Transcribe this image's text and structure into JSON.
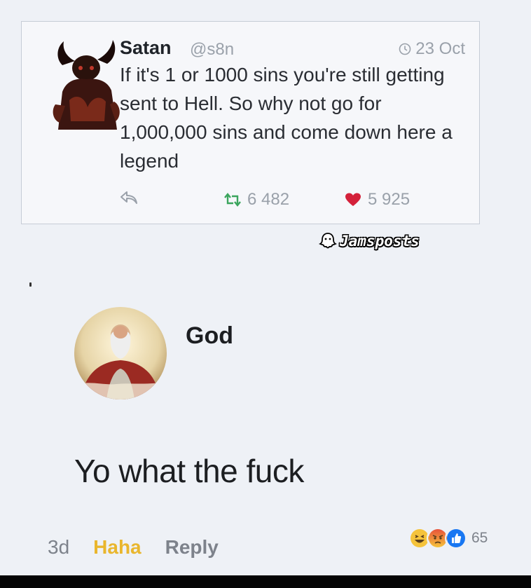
{
  "tweet": {
    "name": "Satan",
    "handle": "@s8n",
    "date": "23 Oct",
    "text": "If it's 1 or 1000 sins you're still getting sent to Hell. So why not go for 1,000,000 sins and come down here a legend",
    "retweets": "6 482",
    "likes": "5 925",
    "colors": {
      "retweet": "#3ba55d",
      "like": "#d4213a"
    }
  },
  "watermark": {
    "text": "Jamsposts",
    "icon": "ghost-icon"
  },
  "comment": {
    "name": "God",
    "text": "Yo what the fuck",
    "time": "3d",
    "haha_label": "Haha",
    "reply_label": "Reply",
    "reaction_count": "65",
    "reactions": [
      "haha-icon",
      "angry-icon",
      "like-icon"
    ]
  }
}
